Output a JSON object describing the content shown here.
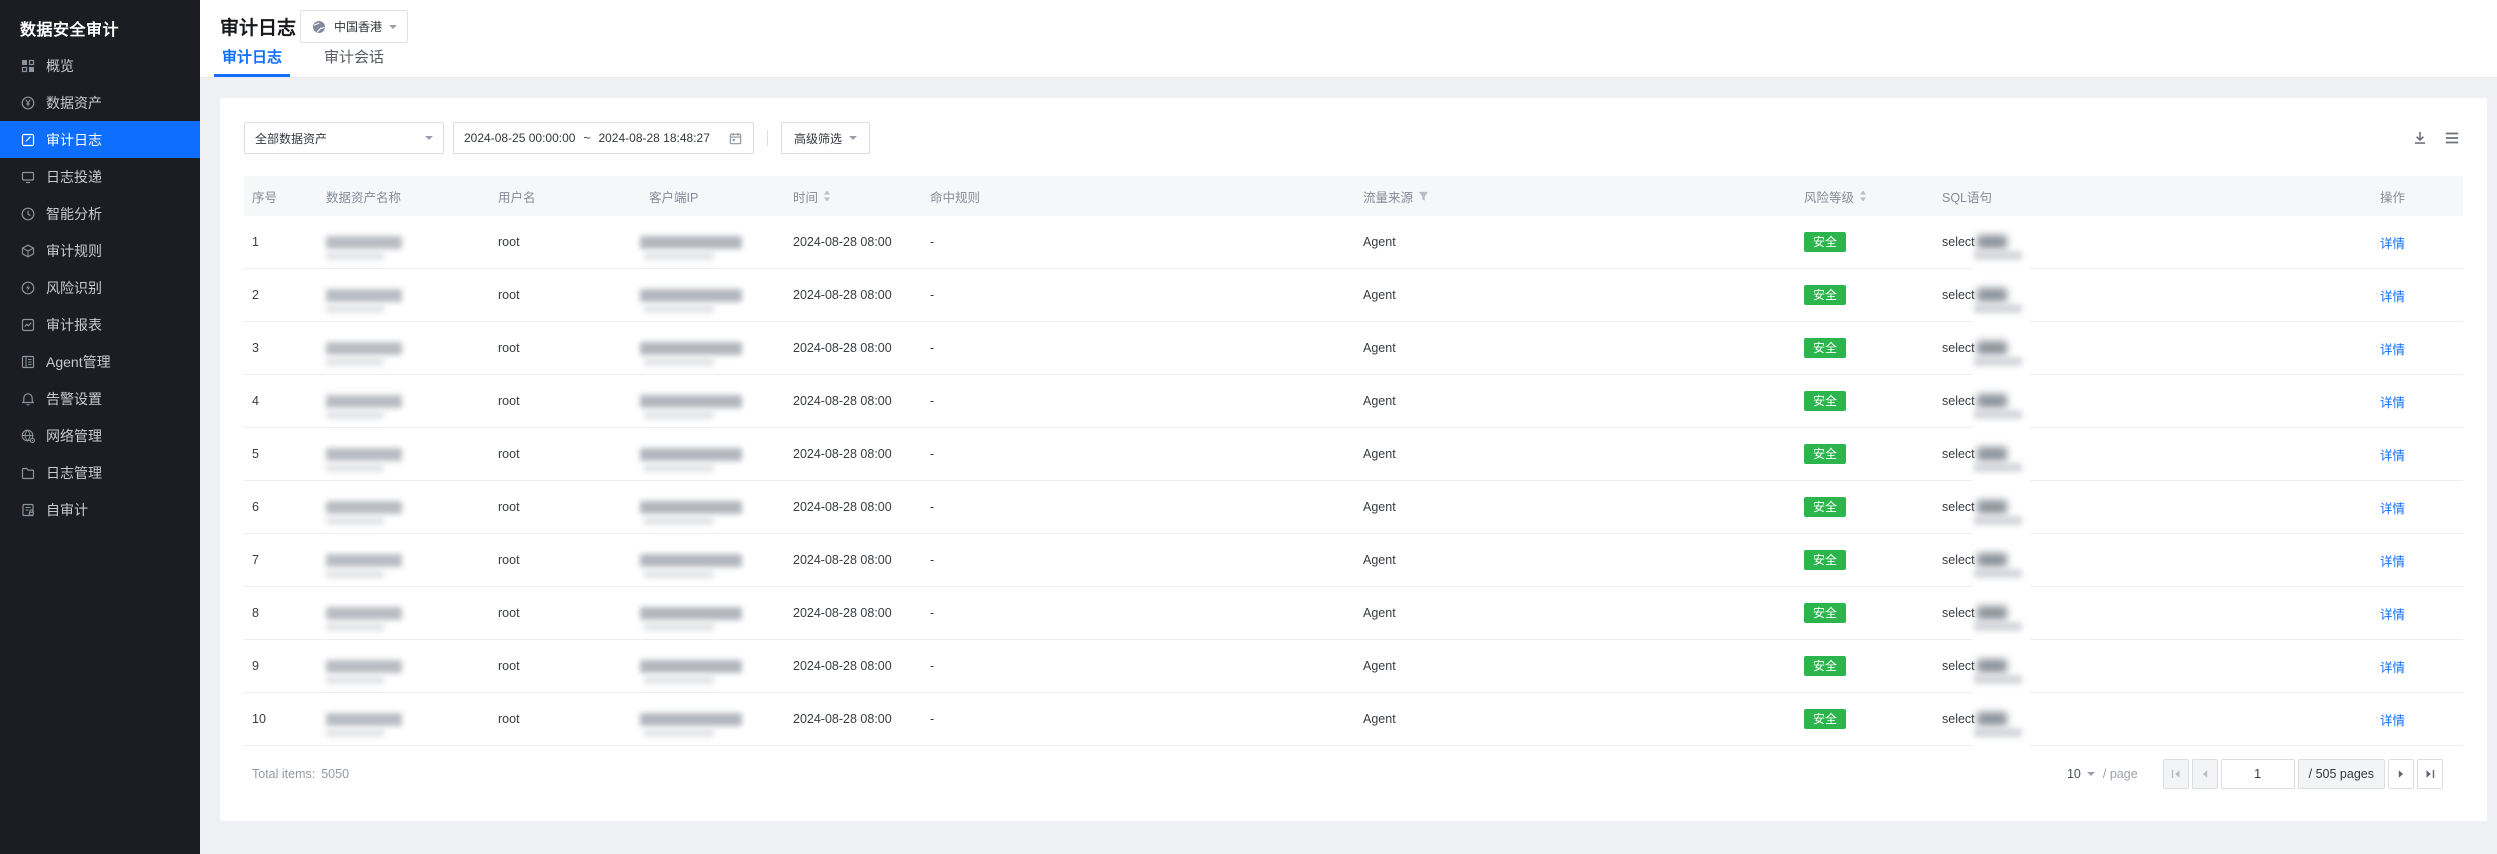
{
  "app": {
    "title": "数据安全审计"
  },
  "sidebar": {
    "items": [
      {
        "label": "概览",
        "icon": "overview-icon",
        "active": false
      },
      {
        "label": "数据资产",
        "icon": "data-assets-icon",
        "active": false
      },
      {
        "label": "审计日志",
        "icon": "audit-logs-icon",
        "active": true
      },
      {
        "label": "日志投递",
        "icon": "log-delivery-icon",
        "active": false
      },
      {
        "label": "智能分析",
        "icon": "intelligent-analysis-icon",
        "active": false
      },
      {
        "label": "审计规则",
        "icon": "audit-rules-icon",
        "active": false
      },
      {
        "label": "风险识别",
        "icon": "risk-identification-icon",
        "active": false
      },
      {
        "label": "审计报表",
        "icon": "audit-reports-icon",
        "active": false
      },
      {
        "label": "Agent管理",
        "icon": "agent-management-icon",
        "active": false
      },
      {
        "label": "告警设置",
        "icon": "alert-settings-icon",
        "active": false
      },
      {
        "label": "网络管理",
        "icon": "network-management-icon",
        "active": false
      },
      {
        "label": "日志管理",
        "icon": "log-management-icon",
        "active": false
      },
      {
        "label": "自审计",
        "icon": "self-audit-icon",
        "active": false
      }
    ]
  },
  "header": {
    "title": "审计日志",
    "region": {
      "label": "中国香港",
      "icon": "globe-icon"
    }
  },
  "tabs": [
    {
      "label": "审计日志",
      "active": true
    },
    {
      "label": "审计会话",
      "active": false
    }
  ],
  "filters": {
    "asset_select": {
      "value": "全部数据资产"
    },
    "date_range": {
      "start": "2024-08-25 00:00:00",
      "separator": "~",
      "end": "2024-08-28 18:48:27"
    },
    "advanced_label": "高级筛选"
  },
  "table": {
    "columns": [
      "序号",
      "数据资产名称",
      "用户名",
      "客户端IP",
      "时间",
      "命中规则",
      "流量来源",
      "风险等级",
      "SQL语句",
      "操作"
    ],
    "rows": [
      {
        "no": "1",
        "asset_redacted": true,
        "user": "root",
        "client_ip_redacted": true,
        "time": "2024-08-28 08:00",
        "hit_rule": "-",
        "traffic_source": "Agent",
        "risk_level": "安全",
        "sql": "select",
        "sql_redacted": true,
        "action": "详情"
      },
      {
        "no": "2",
        "asset_redacted": true,
        "user": "root",
        "client_ip_redacted": true,
        "time": "2024-08-28 08:00",
        "hit_rule": "-",
        "traffic_source": "Agent",
        "risk_level": "安全",
        "sql": "select",
        "sql_redacted": true,
        "action": "详情"
      },
      {
        "no": "3",
        "asset_redacted": true,
        "user": "root",
        "client_ip_redacted": true,
        "time": "2024-08-28 08:00",
        "hit_rule": "-",
        "traffic_source": "Agent",
        "risk_level": "安全",
        "sql": "select",
        "sql_redacted": true,
        "action": "详情"
      },
      {
        "no": "4",
        "asset_redacted": true,
        "user": "root",
        "client_ip_redacted": true,
        "time": "2024-08-28 08:00",
        "hit_rule": "-",
        "traffic_source": "Agent",
        "risk_level": "安全",
        "sql": "select",
        "sql_redacted": true,
        "action": "详情"
      },
      {
        "no": "5",
        "asset_redacted": true,
        "user": "root",
        "client_ip_redacted": true,
        "time": "2024-08-28 08:00",
        "hit_rule": "-",
        "traffic_source": "Agent",
        "risk_level": "安全",
        "sql": "select",
        "sql_redacted": true,
        "action": "详情"
      },
      {
        "no": "6",
        "asset_redacted": true,
        "user": "root",
        "client_ip_redacted": true,
        "time": "2024-08-28 08:00",
        "hit_rule": "-",
        "traffic_source": "Agent",
        "risk_level": "安全",
        "sql": "select",
        "sql_redacted": true,
        "action": "详情"
      },
      {
        "no": "7",
        "asset_redacted": true,
        "user": "root",
        "client_ip_redacted": true,
        "time": "2024-08-28 08:00",
        "hit_rule": "-",
        "traffic_source": "Agent",
        "risk_level": "安全",
        "sql": "select",
        "sql_redacted": true,
        "action": "详情"
      },
      {
        "no": "8",
        "asset_redacted": true,
        "user": "root",
        "client_ip_redacted": true,
        "time": "2024-08-28 08:00",
        "hit_rule": "-",
        "traffic_source": "Agent",
        "risk_level": "安全",
        "sql": "select",
        "sql_redacted": true,
        "action": "详情"
      },
      {
        "no": "9",
        "asset_redacted": true,
        "user": "root",
        "client_ip_redacted": true,
        "time": "2024-08-28 08:00",
        "hit_rule": "-",
        "traffic_source": "Agent",
        "risk_level": "安全",
        "sql": "select",
        "sql_redacted": true,
        "action": "详情"
      },
      {
        "no": "10",
        "asset_redacted": true,
        "user": "root",
        "client_ip_redacted": true,
        "time": "2024-08-28 08:00",
        "hit_rule": "-",
        "traffic_source": "Agent",
        "risk_level": "安全",
        "sql": "select",
        "sql_redacted": true,
        "action": "详情"
      }
    ]
  },
  "pagination": {
    "total_label": "Total items:",
    "total_value": "5050",
    "page_size": "10",
    "per_page_label": "/ page",
    "current_page": "1",
    "pages_label": "/ 505 pages"
  },
  "colors": {
    "accent_blue": "#0E6EFF",
    "risk_safe_green": "#2BB54C",
    "sidebar_bg": "#1B1D23"
  }
}
